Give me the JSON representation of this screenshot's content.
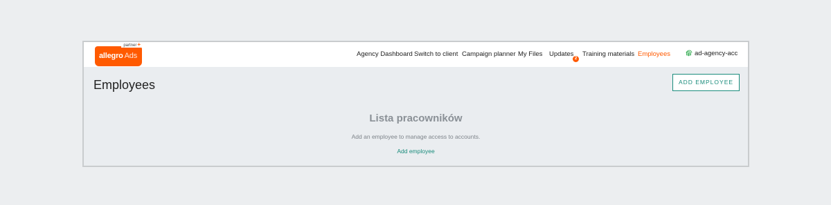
{
  "brand": {
    "name": "allegro",
    "product": "Ads",
    "partner_label": "partner",
    "partner_plus": "+",
    "accent_color": "#ff5a00"
  },
  "nav": {
    "items": [
      {
        "label": "Agency Dashboard",
        "active": false
      },
      {
        "label": "Switch to client",
        "active": false
      },
      {
        "label": "Campaign planner",
        "active": false
      },
      {
        "label": "My Files",
        "active": false
      },
      {
        "label": "Updates",
        "active": false,
        "badge": "2"
      },
      {
        "label": "Training materials",
        "active": false
      },
      {
        "label": "Employees",
        "active": true
      }
    ],
    "account": {
      "label": "ad-agency-acc",
      "icon": "fingerprint-icon"
    }
  },
  "page": {
    "title": "Employees",
    "add_button_label": "ADD EMPLOYEE"
  },
  "empty_state": {
    "heading": "Lista pracowników",
    "text": "Add an employee to manage access to accounts.",
    "link_label": "Add employee"
  },
  "colors": {
    "link": "#1a8c7c",
    "active_nav": "#ff5a00",
    "background": "#eaedf0"
  }
}
